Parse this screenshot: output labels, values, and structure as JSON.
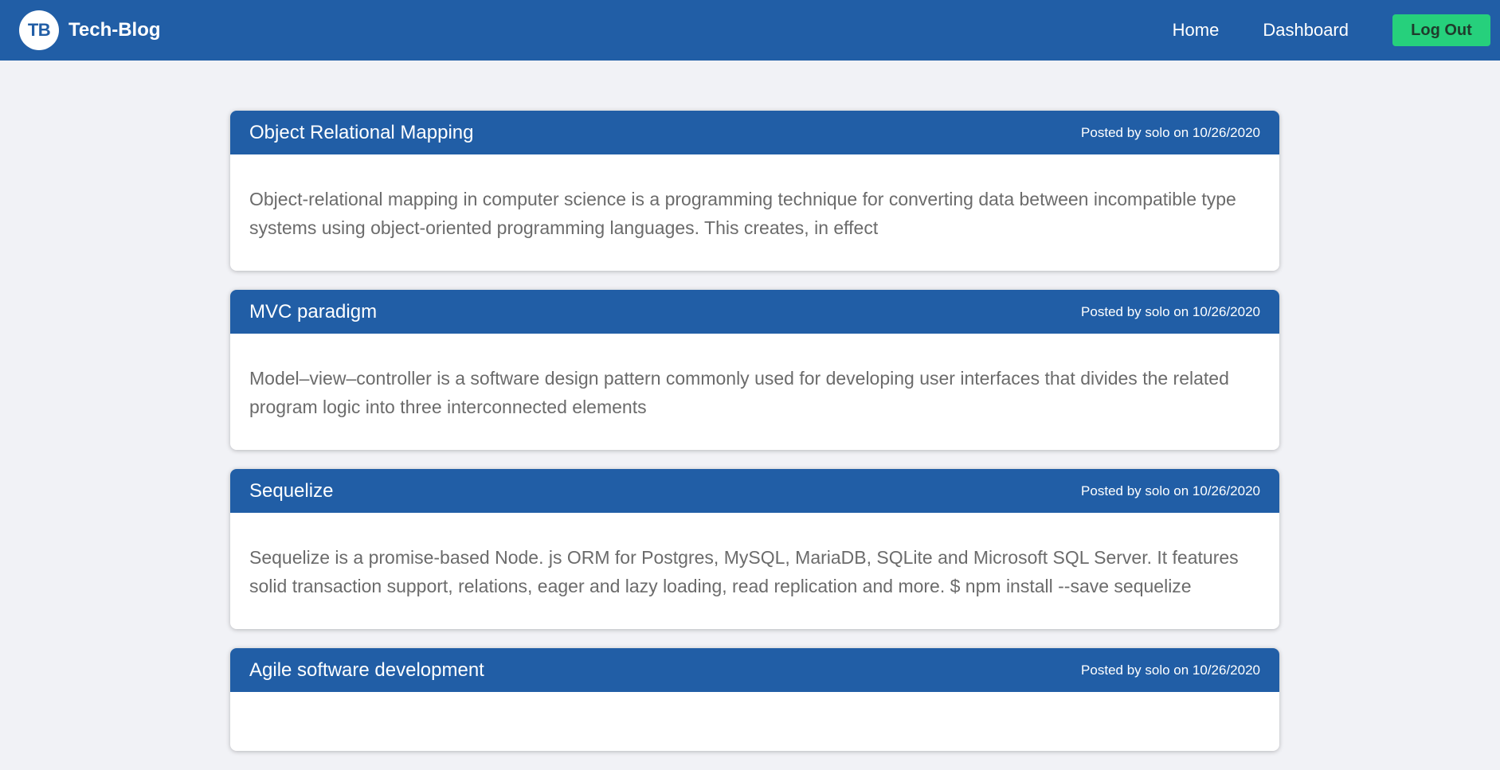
{
  "navbar": {
    "logo_text": "TB",
    "brand": "Tech-Blog",
    "links": [
      "Home",
      "Dashboard"
    ],
    "logout_label": "Log Out",
    "colors": {
      "bar": "#215ea6",
      "logout": "#26d07c"
    }
  },
  "posts": [
    {
      "title": "Object Relational Mapping",
      "meta": "Posted by solo on 10/26/2020",
      "body": "Object-relational mapping in computer science is a programming technique for converting data between incompatible type systems using object-oriented programming languages. This creates, in effect"
    },
    {
      "title": "MVC paradigm",
      "meta": "Posted by solo on 10/26/2020",
      "body": "Model–view–controller is a software design pattern commonly used for developing user interfaces that divides the related program logic into three interconnected elements"
    },
    {
      "title": "Sequelize",
      "meta": "Posted by solo on 10/26/2020",
      "body": "Sequelize is a promise-based Node. js ORM for Postgres, MySQL, MariaDB, SQLite and Microsoft SQL Server. It features solid transaction support, relations, eager and lazy loading, read replication and more. $ npm install --save sequelize"
    },
    {
      "title": "Agile software development",
      "meta": "Posted by solo on 10/26/2020",
      "body": ""
    }
  ]
}
